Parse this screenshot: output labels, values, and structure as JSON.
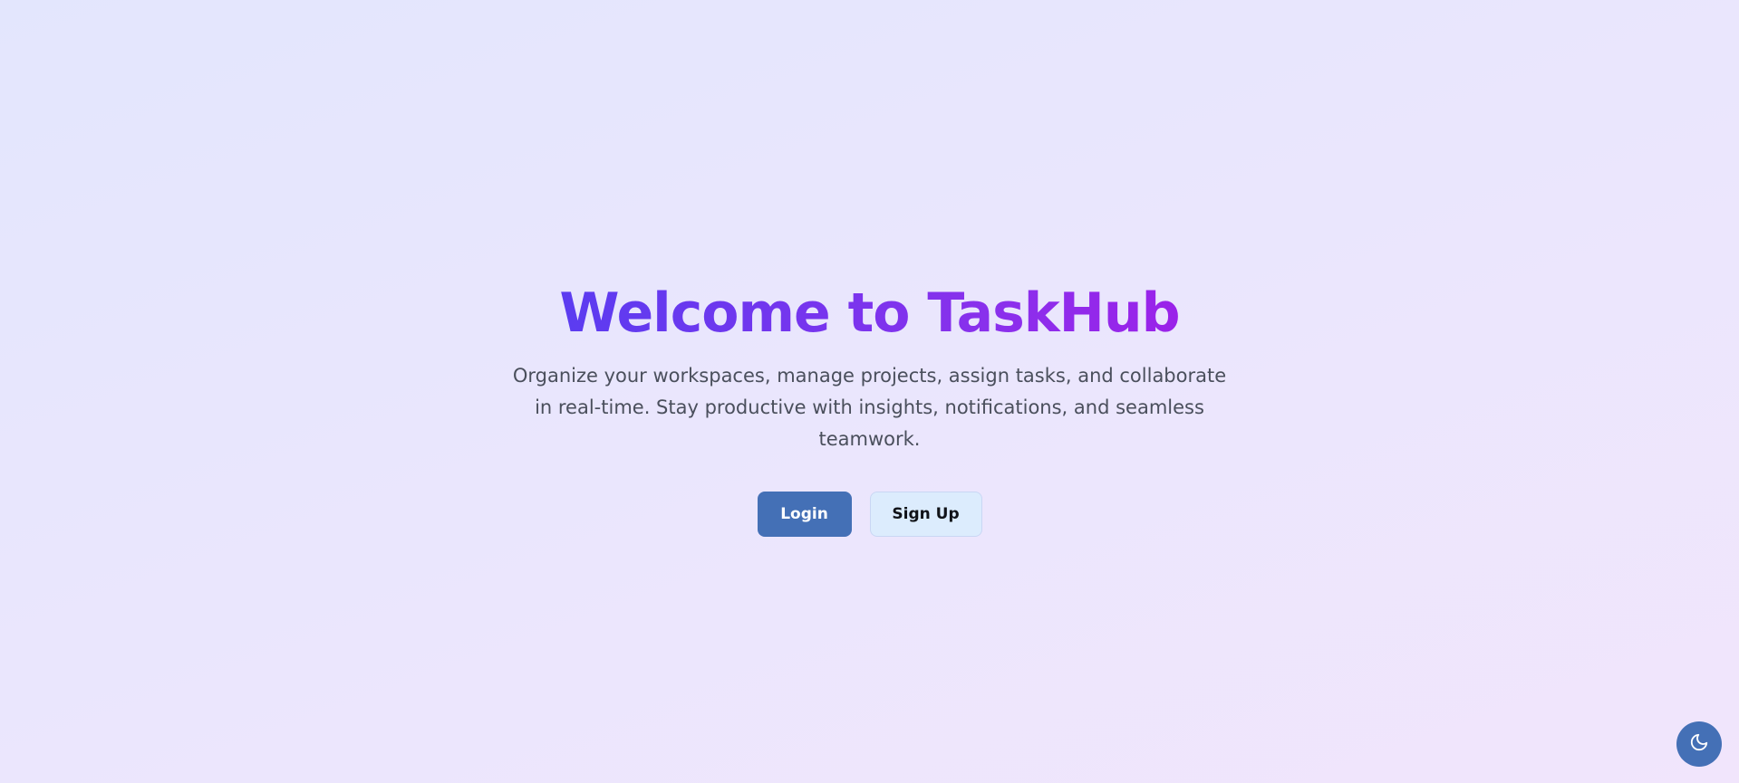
{
  "hero": {
    "title": "Welcome to TaskHub",
    "subtitle": "Organize your workspaces, manage projects, assign tasks, and collaborate in real-time. Stay productive with insights, notifications, and seamless teamwork."
  },
  "actions": {
    "login_label": "Login",
    "signup_label": "Sign Up"
  },
  "theme_toggle": {
    "icon": "moon-icon"
  },
  "colors": {
    "primary": "#4470b6",
    "secondary_bg": "#dcecfd",
    "title_gradient_start": "#5b3cf0",
    "title_gradient_end": "#9b22e9",
    "subtitle_text": "#4a4f5c"
  }
}
